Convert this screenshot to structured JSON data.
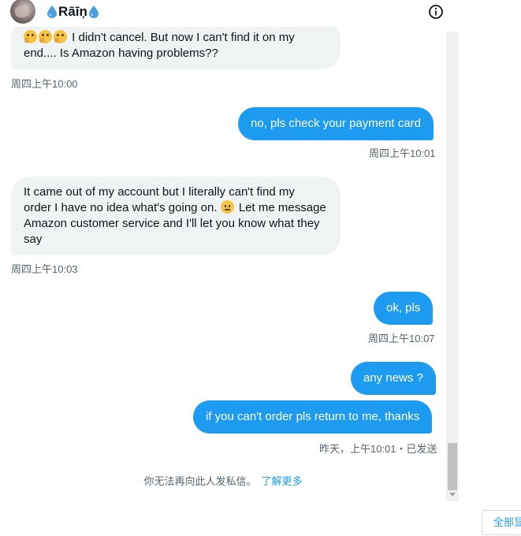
{
  "header": {
    "name": "Rāīņ",
    "icons": {
      "avatar": "profile-avatar",
      "drop_left": "water-drop-icon",
      "drop_right": "water-drop-icon",
      "info": "info-icon"
    }
  },
  "messages": [
    {
      "id": "m1",
      "direction": "incoming",
      "emoji_prefix": [
        "thinking-face",
        "thinking-face",
        "thinking-face"
      ],
      "line1": "I didn't cancel. But now I can't find it on my",
      "line2": "end.... Is Amazon having problems??",
      "time": "周四上午10:00"
    },
    {
      "id": "m2",
      "direction": "outgoing",
      "text": "no, pls check your payment card",
      "time": "周四上午10:01"
    },
    {
      "id": "m3",
      "direction": "incoming",
      "line1": "It came out of my account but I literally can't find my",
      "line2a": "order I have no idea what's going on.",
      "emoji_mid": "confused-face",
      "line2b": "Let me message",
      "line3": "Amazon customer service and I'll let you know what they",
      "line4": "say",
      "time": "周四上午10:03"
    },
    {
      "id": "m4",
      "direction": "outgoing",
      "text": "ok, pls",
      "time": "周四上午10:07"
    },
    {
      "id": "m5",
      "direction": "outgoing",
      "text": "any news ?"
    },
    {
      "id": "m6",
      "direction": "outgoing",
      "text": "if you can't order pls return to me, thanks",
      "time": "昨天，上午10:01・已发送"
    }
  ],
  "notice": {
    "text": "你无法再向此人发私信。",
    "link": "了解更多"
  },
  "side_button": {
    "label": "全部显"
  },
  "colors": {
    "accent": "#1d9bf0",
    "incoming_bubble": "#eff3f4",
    "timestamp": "#536471"
  }
}
